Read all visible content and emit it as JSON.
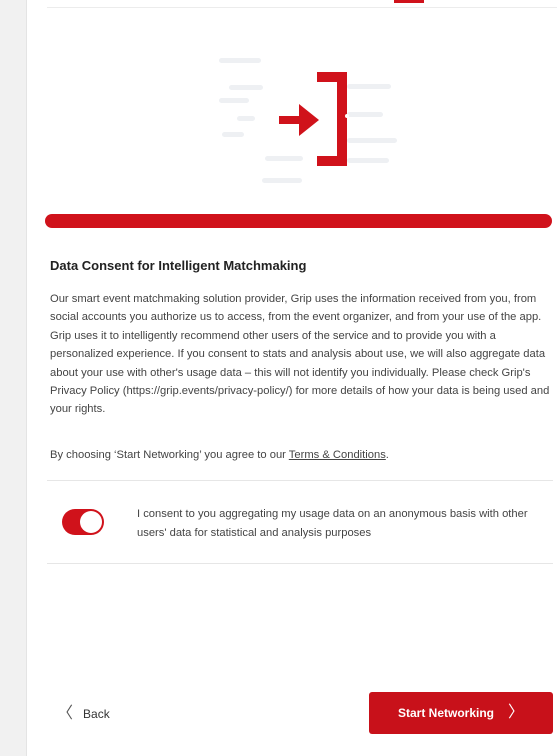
{
  "colors": {
    "accent": "#d0121b",
    "button_bg": "#c8111a"
  },
  "icons": {
    "illustration": "login-arrow-bracket-icon",
    "back": "chevron-left-icon",
    "next": "chevron-right-icon"
  },
  "progress": {
    "value": 1.0
  },
  "consent": {
    "title": "Data Consent for Intelligent Matchmaking",
    "body": "Our smart event matchmaking solution provider, Grip uses the information received from you, from social accounts you authorize us to access, from the event organizer, and from your use of the app. Grip uses it to intelligently recommend other users of the service and to provide you with a personalized experience. If you consent to stats and analysis about use, we will also aggregate data about your use with other's usage data – this will not identify you individually. Please check Grip's Privacy Policy (https://grip.events/privacy-policy/) for more details of how your data is being used and your rights.",
    "agree_prefix": "By choosing ‘Start Networking’ you agree to our ",
    "terms_link": "Terms & Conditions",
    "agree_suffix": ".",
    "toggle_on": true,
    "toggle_text": "I consent to you aggregating my usage data on an anonymous basis with other users' data for statistical and analysis purposes"
  },
  "footer": {
    "back_label": "Back",
    "start_label": "Start Networking"
  }
}
